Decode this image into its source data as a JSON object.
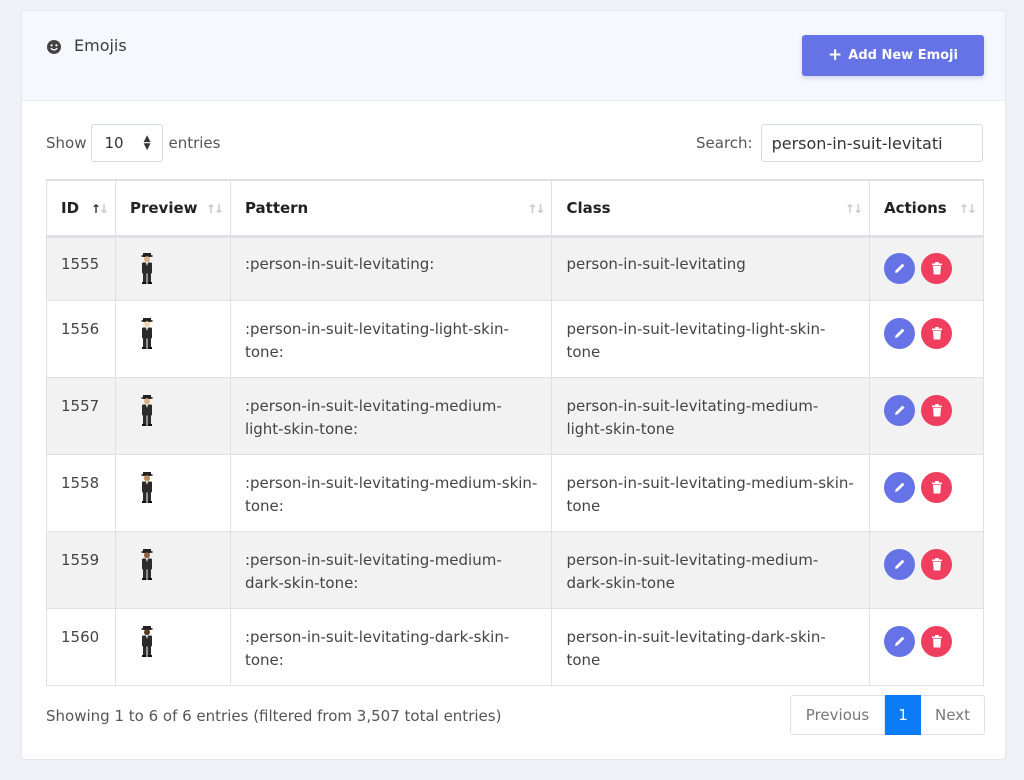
{
  "header": {
    "title": "Emojis",
    "add_button_label": "Add New Emoji"
  },
  "controls": {
    "show_label": "Show",
    "entries_label": "entries",
    "page_length": "10",
    "search_label": "Search:",
    "search_value": "person-in-suit-levitati"
  },
  "table": {
    "columns": [
      "ID",
      "Preview",
      "Pattern",
      "Class",
      "Actions"
    ],
    "rows": [
      {
        "id": "1555",
        "pattern": ":person-in-suit-levitating:",
        "class": "person-in-suit-levitating"
      },
      {
        "id": "1556",
        "pattern": ":person-in-suit-levitating-light-skin-tone:",
        "class": "person-in-suit-levitating-light-skin-tone"
      },
      {
        "id": "1557",
        "pattern": ":person-in-suit-levitating-medium-light-skin-tone:",
        "class": "person-in-suit-levitating-medium-light-skin-tone"
      },
      {
        "id": "1558",
        "pattern": ":person-in-suit-levitating-medium-skin-tone:",
        "class": "person-in-suit-levitating-medium-skin-tone"
      },
      {
        "id": "1559",
        "pattern": ":person-in-suit-levitating-medium-dark-skin-tone:",
        "class": "person-in-suit-levitating-medium-dark-skin-tone"
      },
      {
        "id": "1560",
        "pattern": ":person-in-suit-levitating-dark-skin-tone:",
        "class": "person-in-suit-levitating-dark-skin-tone"
      }
    ]
  },
  "footer": {
    "info": "Showing 1 to 6 of 6 entries (filtered from 3,507 total entries)",
    "previous_label": "Previous",
    "current_page": "1",
    "next_label": "Next"
  },
  "icons": {
    "header": "smile-icon",
    "add": "plus-icon",
    "edit": "pencil-icon",
    "delete": "trash-icon",
    "preview": "person-in-suit-levitating-icon",
    "length_select": "sort-caret-icon"
  },
  "colors": {
    "primary": "#6673e6",
    "danger": "#ef3e5e",
    "page_active": "#0b7cf5"
  }
}
